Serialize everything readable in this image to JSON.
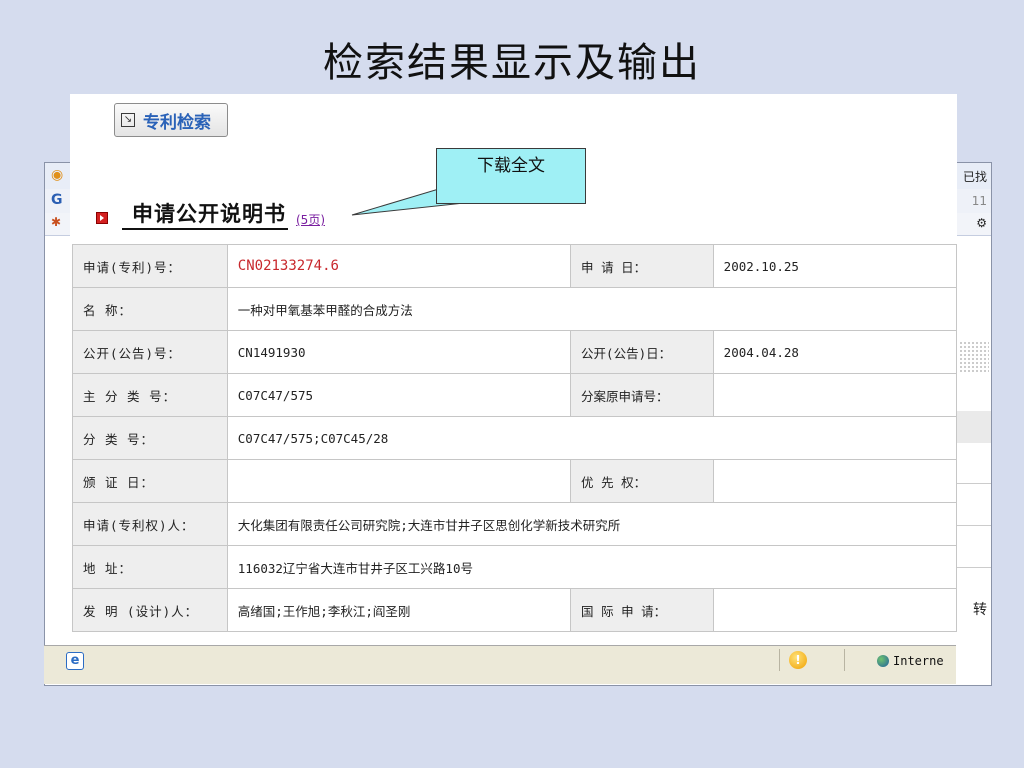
{
  "slide": {
    "title": "检索结果显示及输出"
  },
  "background_window": {
    "right_label_top": "已找",
    "right_label_2": "11 ",
    "right_label_bottom": "转",
    "status_zone": "Interne"
  },
  "toolbar": {
    "search_button_label": "专利检索"
  },
  "callout": {
    "text": "下载全文"
  },
  "document": {
    "title": "申请公开说明书",
    "pages_link": "(5页)"
  },
  "rows": [
    {
      "label": "申请(专利)号：",
      "value": "CN02133274.6",
      "label2": "申  请  日：",
      "value2": "2002.10.25"
    },
    {
      "label": "名          称：",
      "value": "一种对甲氧基苯甲醛的合成方法"
    },
    {
      "label": "公开(公告)号：",
      "value": "CN1491930",
      "label2": "公开(公告)日：",
      "value2": "2004.04.28"
    },
    {
      "label": "主 分 类 号：",
      "value": "C07C47/575",
      "label2": "分案原申请号：",
      "value2": ""
    },
    {
      "label": "分   类   号：",
      "value": "C07C47/575;C07C45/28"
    },
    {
      "label": "颁   证   日：",
      "value": "",
      "label2": "优  先  权：",
      "value2": ""
    },
    {
      "label": "申请(专利权)人：",
      "value": "大化集团有限责任公司研究院;大连市甘井子区思创化学新技术研究所"
    },
    {
      "label": "地          址：",
      "value": "116032辽宁省大连市甘井子区工兴路10号"
    },
    {
      "label": "发 明 (设计)人：",
      "value": "高绪国;王作旭;李秋江;阎圣刚",
      "label2": "国 际 申 请：",
      "value2": ""
    }
  ]
}
